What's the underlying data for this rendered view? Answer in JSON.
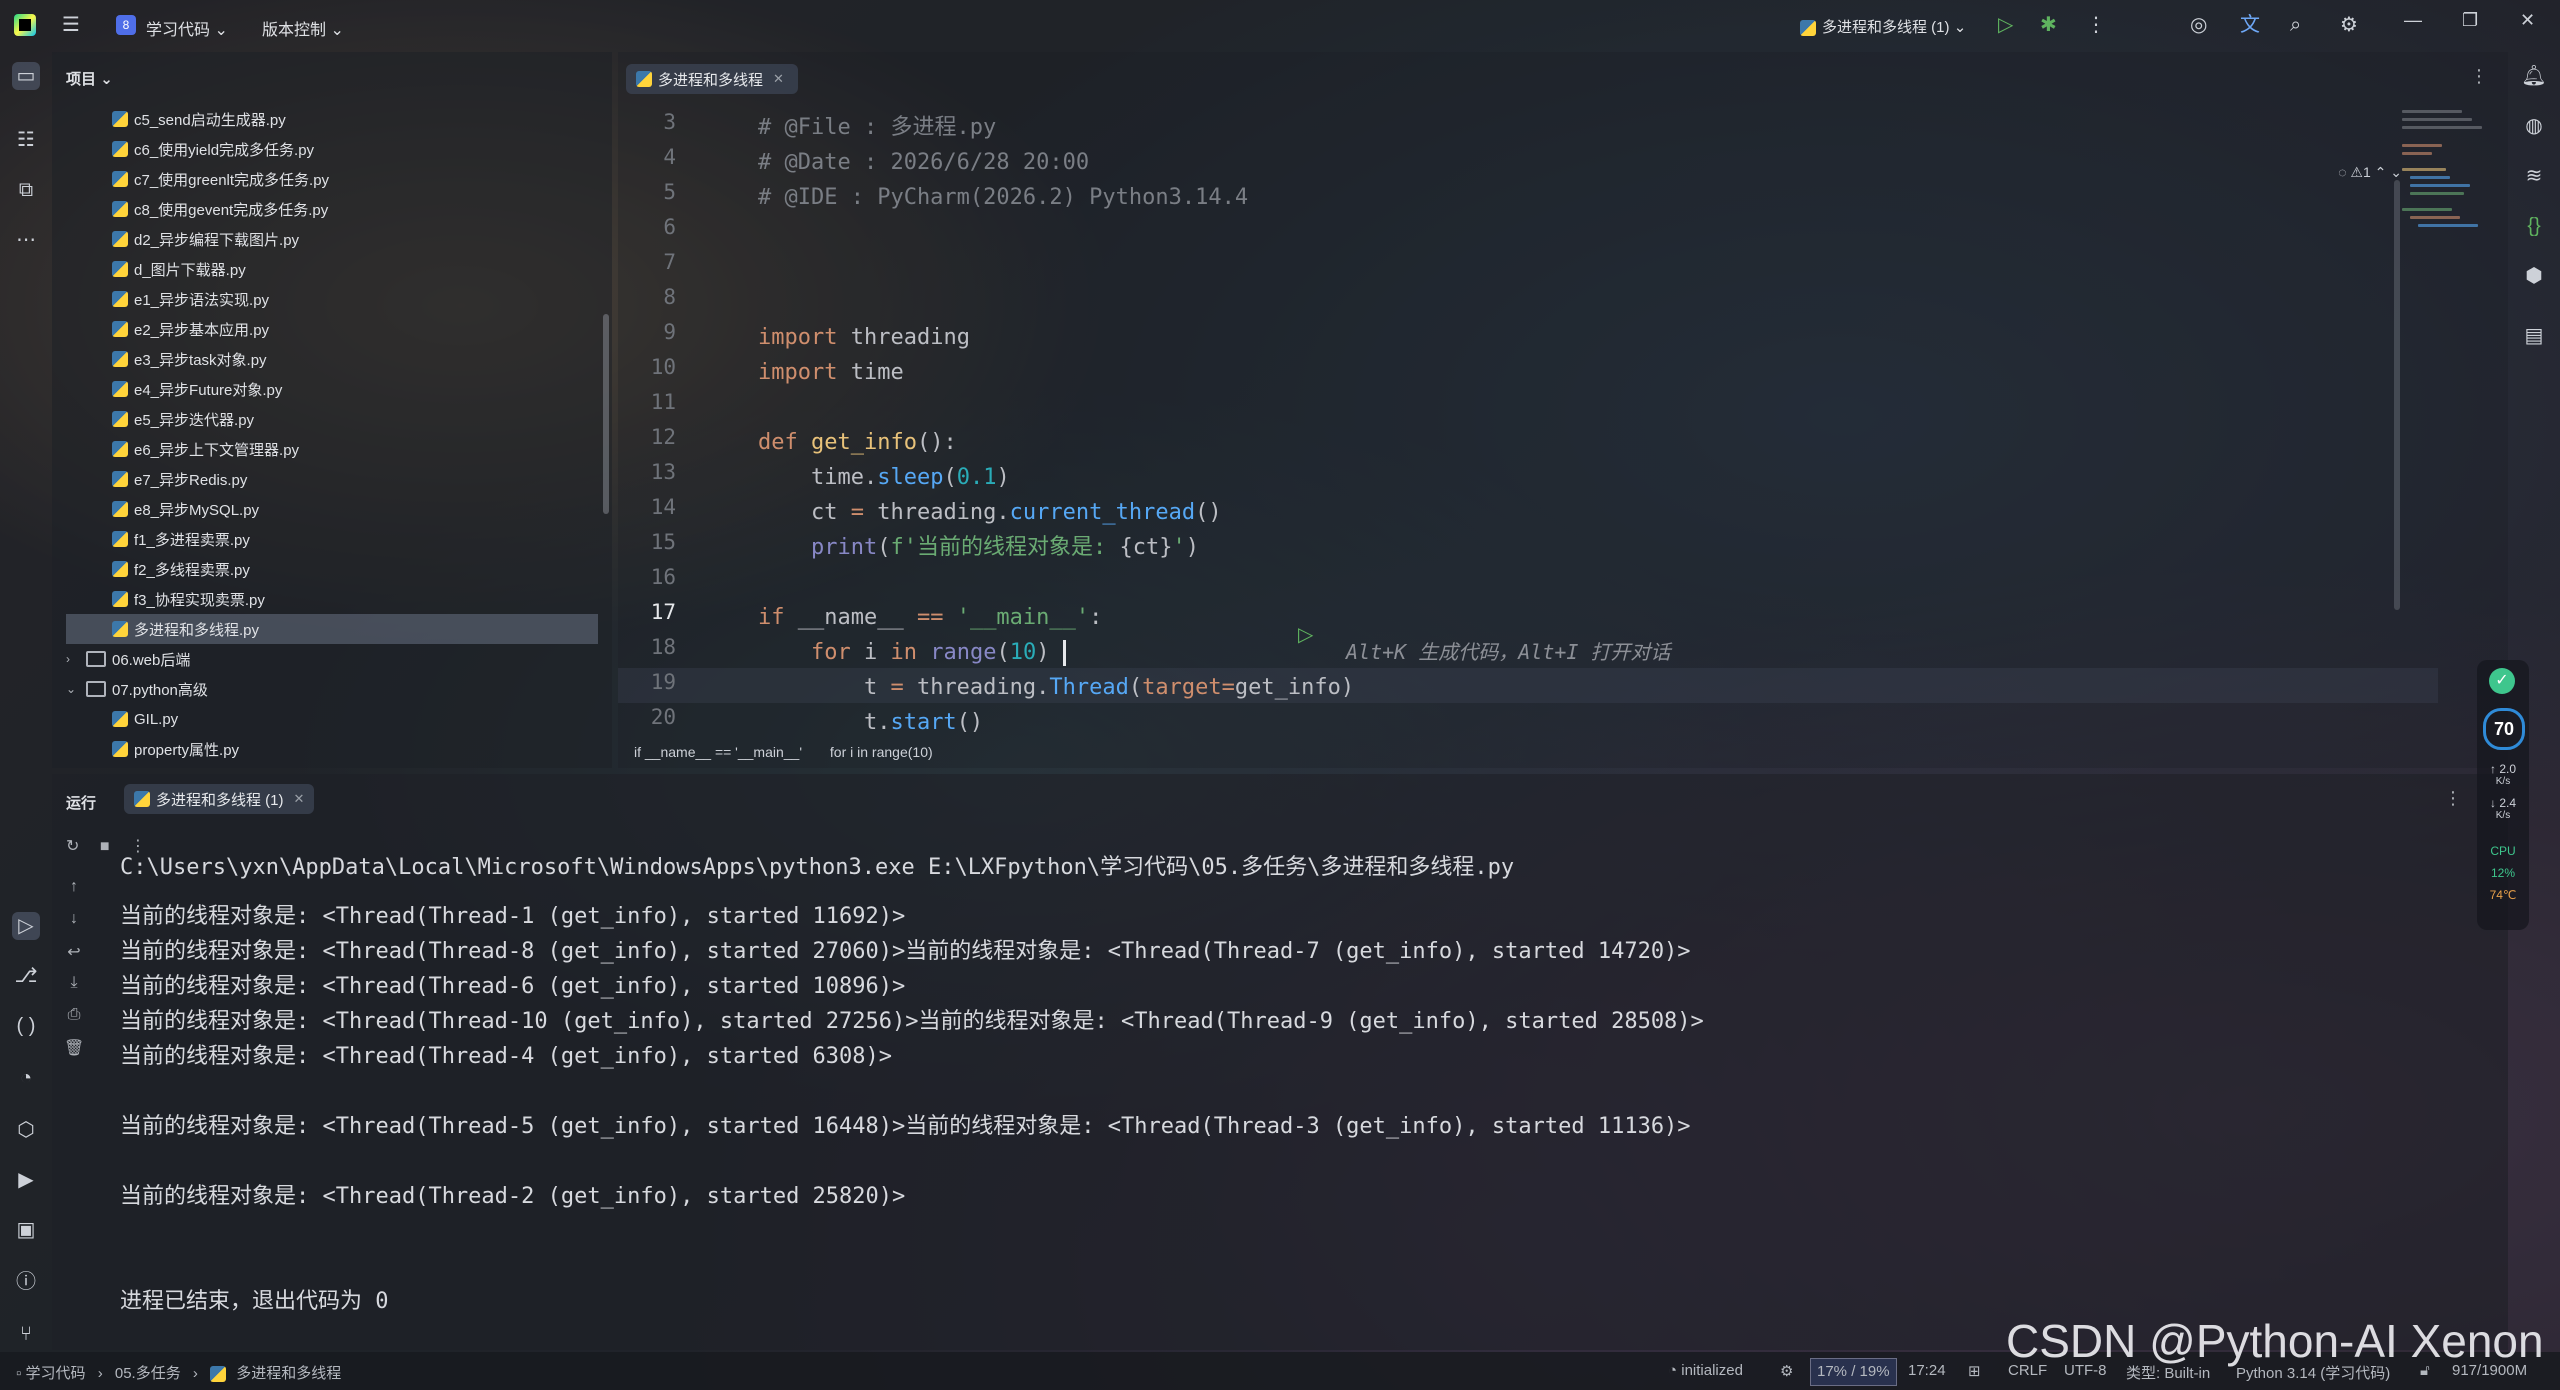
{
  "titlebar": {
    "project_badge": "8",
    "project_name": "学习代码",
    "vcs_label": "版本控制",
    "run_config": "多进程和多线程 (1)"
  },
  "project_panel": {
    "title": "项目",
    "items": [
      {
        "label": "c5_send启动生成器.py",
        "type": "py"
      },
      {
        "label": "c6_使用yield完成多任务.py",
        "type": "py"
      },
      {
        "label": "c7_使用greenlt完成多任务.py",
        "type": "py"
      },
      {
        "label": "c8_使用gevent完成多任务.py",
        "type": "py"
      },
      {
        "label": "d2_异步编程下载图片.py",
        "type": "py"
      },
      {
        "label": "d_图片下载器.py",
        "type": "py"
      },
      {
        "label": "e1_异步语法实现.py",
        "type": "py"
      },
      {
        "label": "e2_异步基本应用.py",
        "type": "py"
      },
      {
        "label": "e3_异步task对象.py",
        "type": "py"
      },
      {
        "label": "e4_异步Future对象.py",
        "type": "py"
      },
      {
        "label": "e5_异步迭代器.py",
        "type": "py"
      },
      {
        "label": "e6_异步上下文管理器.py",
        "type": "py"
      },
      {
        "label": "e7_异步Redis.py",
        "type": "py"
      },
      {
        "label": "e8_异步MySQL.py",
        "type": "py"
      },
      {
        "label": "f1_多进程卖票.py",
        "type": "py"
      },
      {
        "label": "f2_多线程卖票.py",
        "type": "py"
      },
      {
        "label": "f3_协程实现卖票.py",
        "type": "py"
      },
      {
        "label": "多进程和多线程.py",
        "type": "py",
        "selected": true
      },
      {
        "label": "06.web后端",
        "type": "folder",
        "chevron": "›"
      },
      {
        "label": "07.python高级",
        "type": "folder",
        "chevron": "⌄"
      },
      {
        "label": "GIL.py",
        "type": "py"
      },
      {
        "label": "property属性.py",
        "type": "py"
      }
    ]
  },
  "editor": {
    "tab_label": "多进程和多线程",
    "inspection": "⚠1",
    "line_numbers": [
      "3",
      "4",
      "5",
      "6",
      "7",
      "8",
      "9",
      "10",
      "11",
      "12",
      "13",
      "14",
      "15",
      "16",
      "17",
      "18",
      "19",
      "20"
    ],
    "breadcrumb": [
      "if __name__ == '__main__'",
      "for i in range(10)"
    ],
    "code": {
      "l3": "# @File : 多进程.py",
      "l4": "# @Date : 2026/6/28 20:00",
      "l5": "# @IDE : PyCharm(2026.2) Python3.14.4",
      "l8a": "import",
      "l8b": " threading",
      "l9a": "import",
      "l9b": " time",
      "l11a": "def",
      "l11b": " get_info",
      "l11c": "():",
      "l12a": "    time.",
      "l12b": "sleep",
      "l12c": "(",
      "l12d": "0.1",
      "l12e": ")",
      "l13a": "    ct ",
      "l13b": "=",
      "l13c": " threading.",
      "l13d": "current_thread",
      "l13e": "()",
      "l14a": "    print",
      "l14b": "(",
      "l14c": "f'当前的线程对象是: ",
      "l14d": "{ct}",
      "l14e": "'",
      "l14f": ")",
      "l16a": "if",
      "l16b": " __name__ ",
      "l16c": "==",
      "l16d": " '__main__'",
      "l16e": ":",
      "l17a": "    for",
      "l17b": " i ",
      "l17c": "in",
      "l17d": " range",
      "l17e": "(",
      "l17f": "10",
      "l17g": ")",
      "l17hint": "Alt+K 生成代码，Alt+I 打开对话",
      "l18a": "        t ",
      "l18b": "=",
      "l18c": " threading.",
      "l18d": "Thread",
      "l18e": "(",
      "l18f": "target",
      "l18g": "=",
      "l18h": "get_info",
      "l18i": ")",
      "l19a": "        t.",
      "l19b": "start",
      "l19c": "()"
    }
  },
  "run_panel": {
    "title": "运行",
    "tab_label": "多进程和多线程 (1)",
    "console": [
      "C:\\Users\\yxn\\AppData\\Local\\Microsoft\\WindowsApps\\python3.exe E:\\LXFpython\\学习代码\\05.多任务\\多进程和多线程.py",
      "当前的线程对象是: <Thread(Thread-1 (get_info), started 11692)>",
      "当前的线程对象是: <Thread(Thread-8 (get_info), started 27060)>当前的线程对象是: <Thread(Thread-7 (get_info), started 14720)>",
      "当前的线程对象是: <Thread(Thread-6 (get_info), started 10896)>",
      "当前的线程对象是: <Thread(Thread-10 (get_info), started 27256)>当前的线程对象是: <Thread(Thread-9 (get_info), started 28508)>",
      "当前的线程对象是: <Thread(Thread-4 (get_info), started 6308)>",
      "",
      "当前的线程对象是: <Thread(Thread-5 (get_info), started 16448)>当前的线程对象是: <Thread(Thread-3 (get_info), started 11136)>",
      "",
      "当前的线程对象是: <Thread(Thread-2 (get_info), started 25820)>",
      "",
      "",
      "进程已结束，退出代码为 0"
    ]
  },
  "statusbar": {
    "path": [
      "学习代码",
      "05.多任务",
      "多进程和多线程"
    ],
    "initialized": "initialized",
    "memory": "17% / 19%",
    "position": "17:24",
    "line_sep": "CRLF",
    "encoding": "UTF-8",
    "type": "类型: Built-in",
    "interpreter": "Python 3.14 (学习代码)",
    "heap": "917/1900M"
  },
  "widget": {
    "score": "70",
    "up": "2.0",
    "up_unit": "K/s",
    "down": "2.4",
    "down_unit": "K/s",
    "cpu_label": "CPU",
    "cpu": "12%",
    "temp": "74℃"
  },
  "watermark": "CSDN @Python-AI Xenon"
}
